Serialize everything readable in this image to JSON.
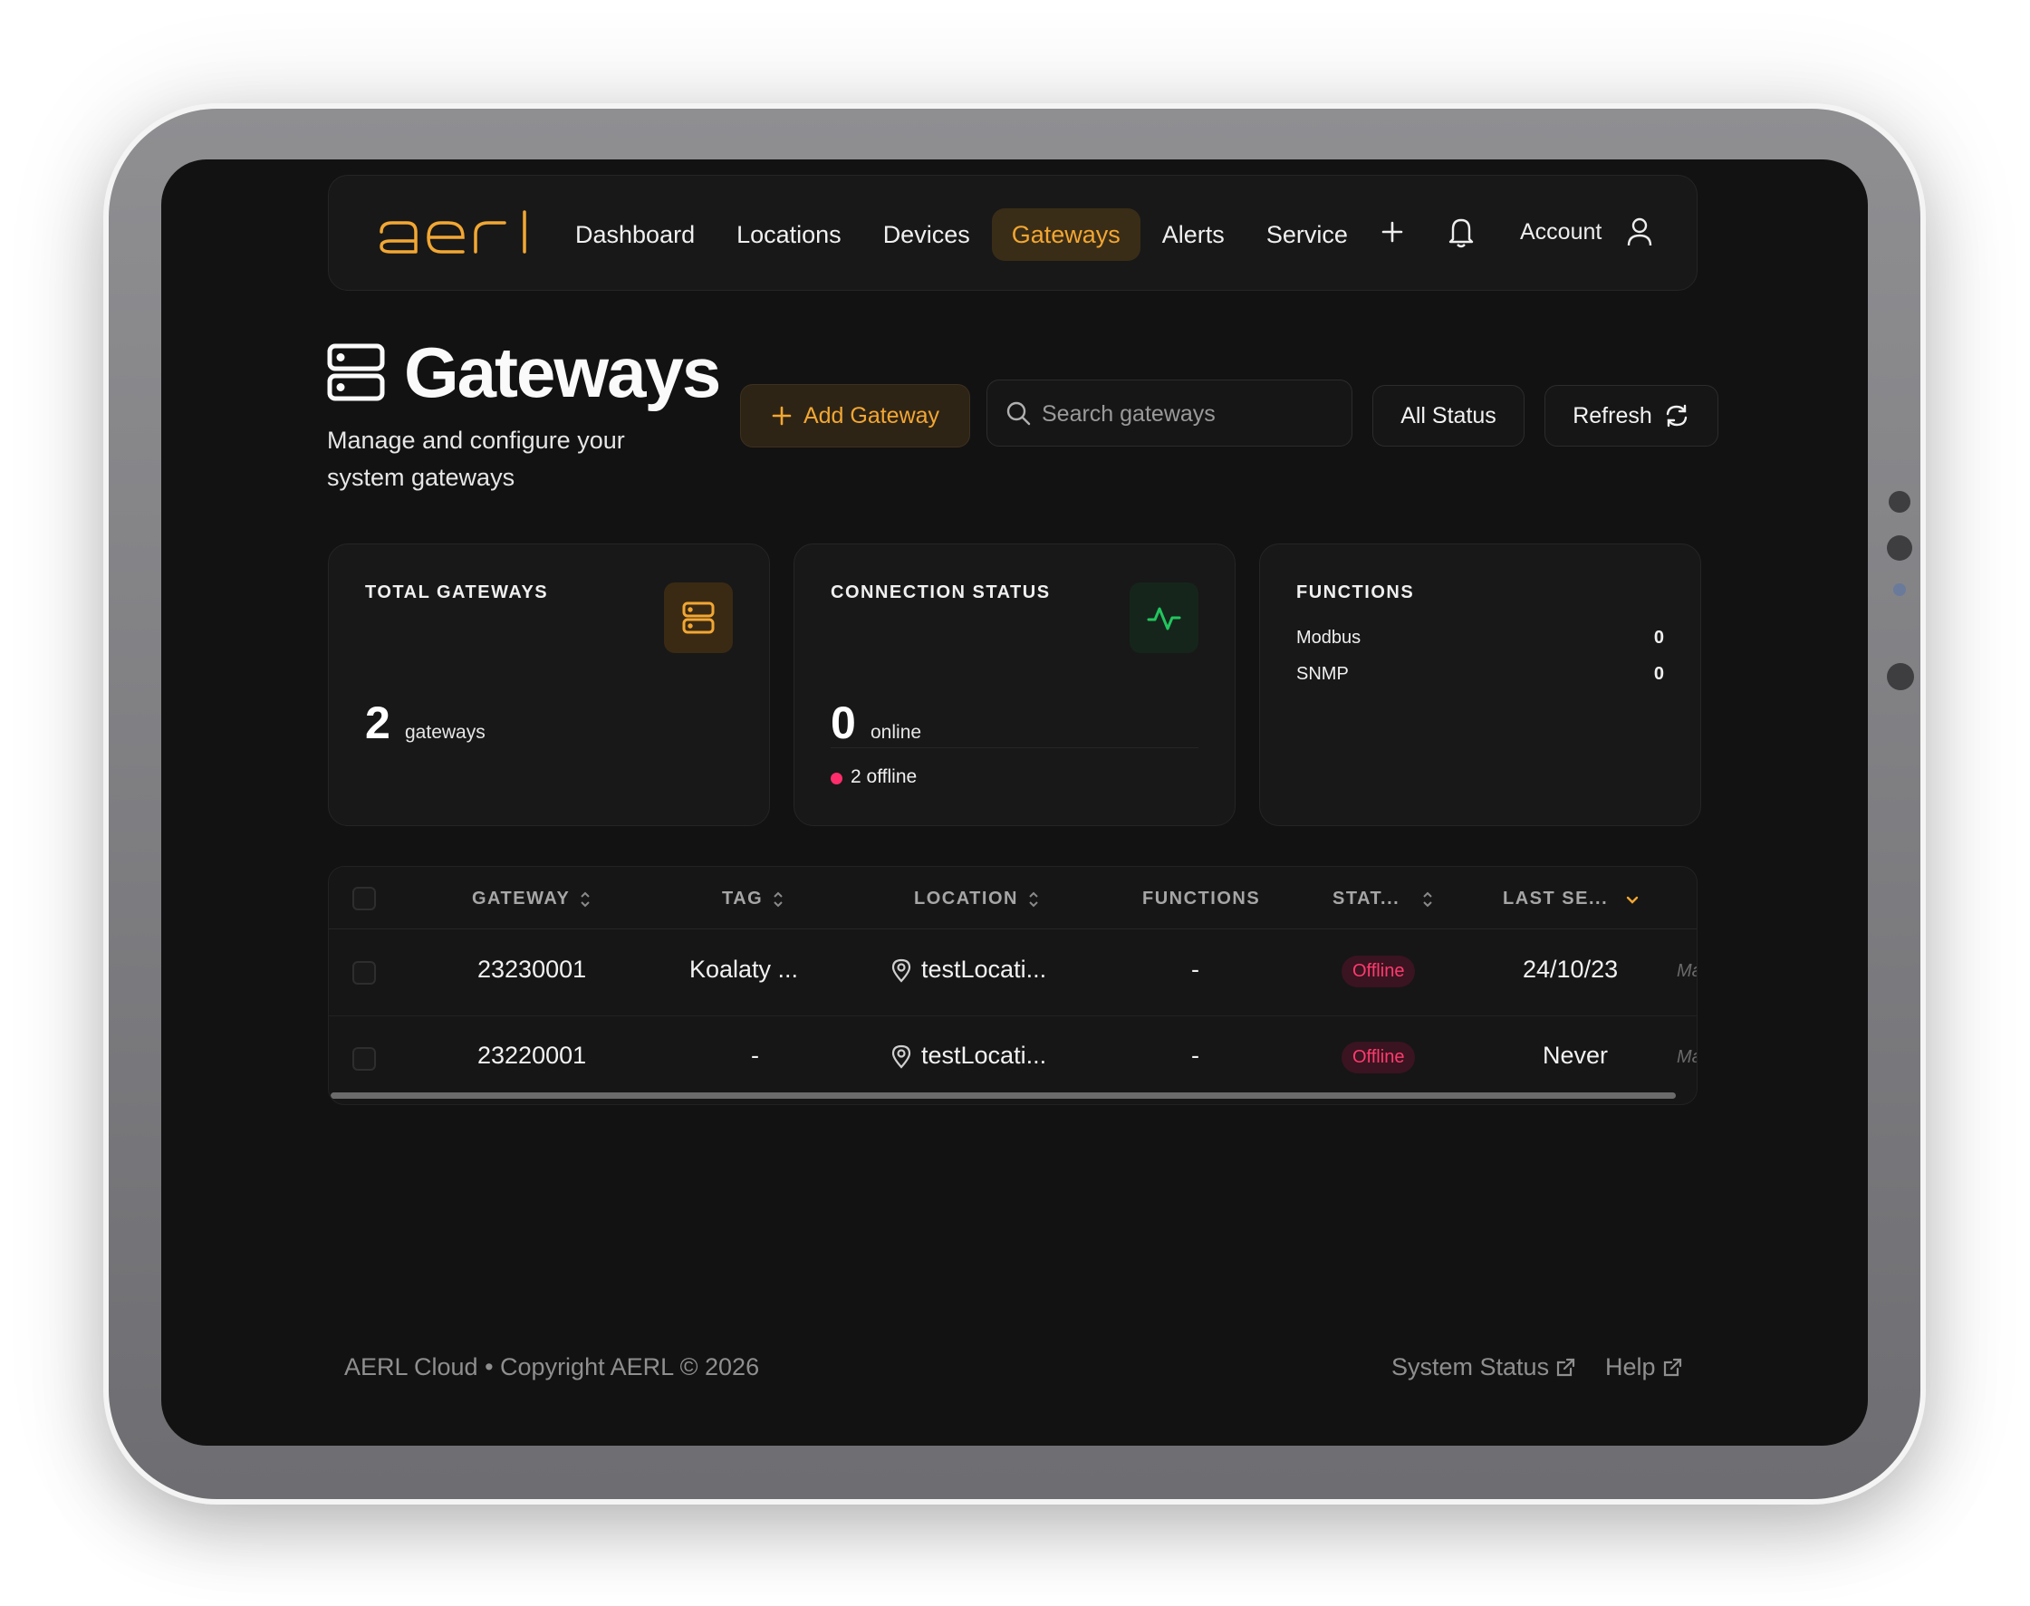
{
  "brand": {
    "logo_text": "aerl",
    "accent": "#f2a733"
  },
  "nav": {
    "items": [
      {
        "label": "Dashboard",
        "active": false
      },
      {
        "label": "Locations",
        "active": false
      },
      {
        "label": "Devices",
        "active": false
      },
      {
        "label": "Gateways",
        "active": true
      },
      {
        "label": "Alerts",
        "active": false
      },
      {
        "label": "Service",
        "active": false
      }
    ],
    "account_label": "Account",
    "icons": [
      "plus-icon",
      "bell-icon",
      "user-icon"
    ]
  },
  "header": {
    "title": "Gateways",
    "subtitle": "Manage and configure your system gateways",
    "add_button": "Add Gateway",
    "search_placeholder": "Search gateways",
    "status_filter": "All Status",
    "refresh_button": "Refresh"
  },
  "cards": {
    "total": {
      "label": "TOTAL GATEWAYS",
      "value": "2",
      "unit": "gateways"
    },
    "connection": {
      "label": "CONNECTION STATUS",
      "value": "0",
      "unit": "online",
      "offline_text": "2 offline"
    },
    "functions": {
      "label": "FUNCTIONS",
      "rows": [
        {
          "name": "Modbus",
          "count": "0"
        },
        {
          "name": "SNMP",
          "count": "0"
        }
      ]
    }
  },
  "table": {
    "columns": [
      "GATEWAY",
      "TAG",
      "LOCATION",
      "FUNCTIONS",
      "STAT...",
      "LAST SE..."
    ],
    "rows": [
      {
        "gateway": "23230001",
        "tag": "Koalaty ...",
        "location": "testLocati...",
        "functions": "-",
        "status": "Offline",
        "last_seen": "24/10/23",
        "cut": "Ma"
      },
      {
        "gateway": "23220001",
        "tag": "-",
        "location": "testLocati...",
        "functions": "-",
        "status": "Offline",
        "last_seen": "Never",
        "cut": "Ma"
      }
    ]
  },
  "footer": {
    "copyright": "AERL Cloud • Copyright AERL © 2026",
    "links": [
      "System Status",
      "Help"
    ]
  },
  "colors": {
    "background": "#121212",
    "offline": "#ff3a6e",
    "online_accent": "#22c55e"
  }
}
